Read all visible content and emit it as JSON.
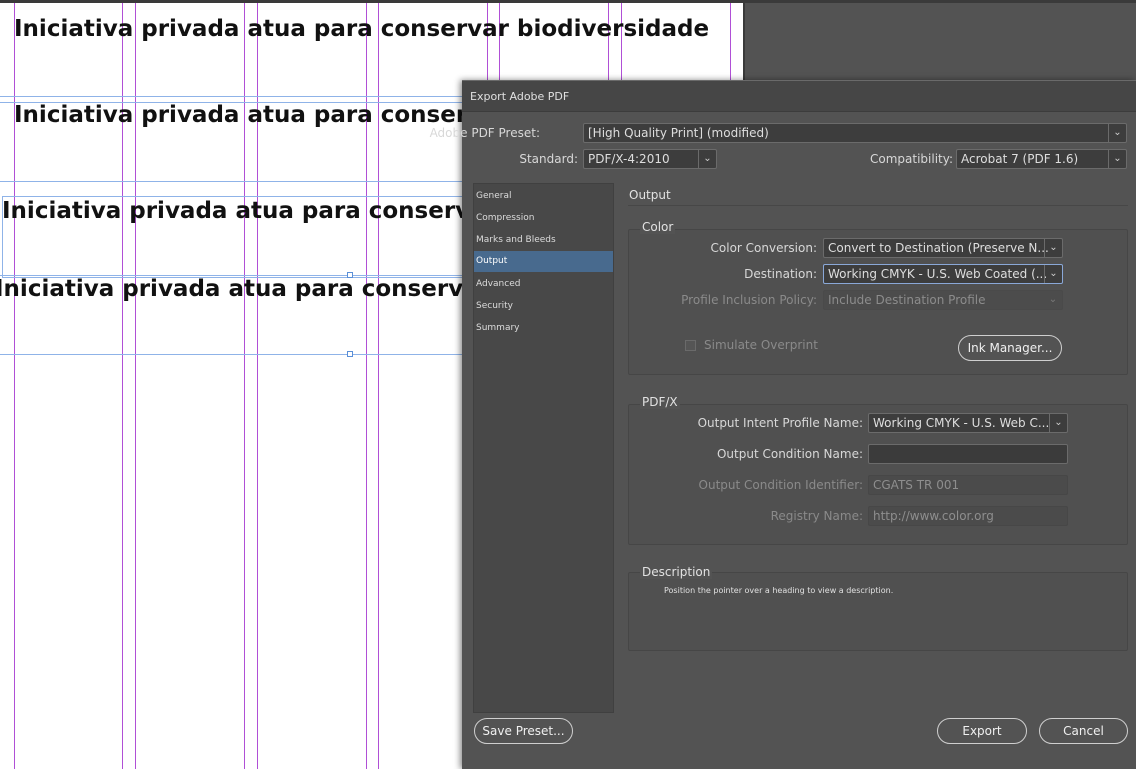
{
  "document": {
    "headlines": [
      "Iniciativa privada atua para conservar biodiversidade",
      "Iniciativa privada atua para conservar biodiversidade",
      "Iniciativa privada atua para conservar biodiversidade",
      "Iniciativa privada atua para conservar biodiversidade"
    ]
  },
  "dialog": {
    "title": "Export Adobe PDF",
    "preset_label": "Adobe PDF Preset:",
    "preset_value": "[High Quality Print] (modified)",
    "standard_label": "Standard:",
    "standard_value": "PDF/X-4:2010",
    "compat_label": "Compatibility:",
    "compat_value": "Acrobat 7 (PDF 1.6)",
    "sidebar": {
      "items": [
        {
          "label": "General"
        },
        {
          "label": "Compression"
        },
        {
          "label": "Marks and Bleeds"
        },
        {
          "label": "Output"
        },
        {
          "label": "Advanced"
        },
        {
          "label": "Security"
        },
        {
          "label": "Summary"
        }
      ],
      "active": "Output"
    },
    "output": {
      "section_title": "Output",
      "color": {
        "title": "Color",
        "conversion_label": "Color Conversion:",
        "conversion_value": "Convert to Destination (Preserve N...",
        "destination_label": "Destination:",
        "destination_value": "Working CMYK - U.S. Web Coated (...",
        "profile_label": "Profile Inclusion Policy:",
        "profile_value": "Include Destination Profile",
        "simulate_label": "Simulate Overprint",
        "ink_manager_label": "Ink Manager..."
      },
      "pdfx": {
        "title": "PDF/X",
        "intent_label": "Output Intent Profile Name:",
        "intent_value": "Working CMYK - U.S. Web C...",
        "condition_name_label": "Output Condition Name:",
        "condition_name_value": "",
        "condition_id_label": "Output Condition Identifier:",
        "condition_id_value": "CGATS TR 001",
        "registry_label": "Registry Name:",
        "registry_value": "http://www.color.org"
      },
      "description": {
        "title": "Description",
        "text": "Position the pointer over a heading to view a description."
      }
    },
    "buttons": {
      "save_preset": "Save Preset...",
      "export": "Export",
      "cancel": "Cancel"
    },
    "chevron": "⌄",
    "colors": {
      "active_item": "#486a8e",
      "guide_purple": "#b04fd6",
      "guide_blue": "#8fb3e8"
    }
  }
}
